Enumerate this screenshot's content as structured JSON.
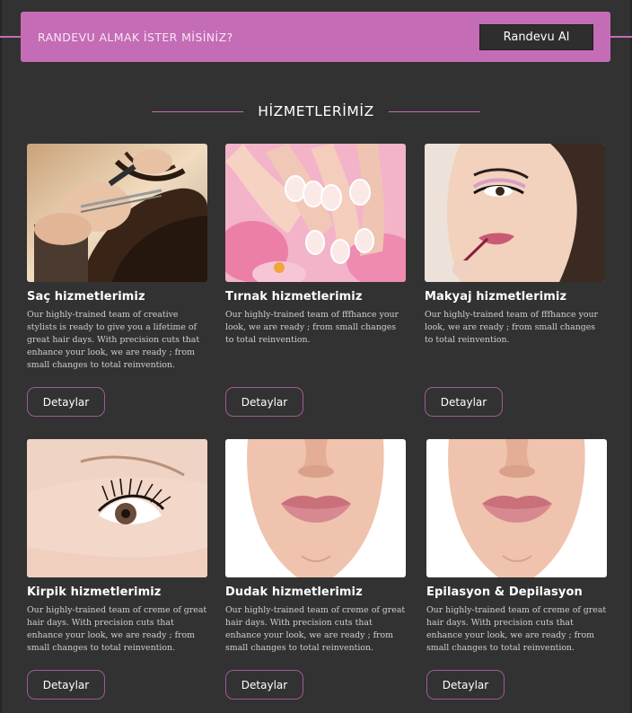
{
  "cta": {
    "text": "RANDEVU ALMAK İSTER MİSİNİZ?",
    "button_label": "Randevu Al"
  },
  "section": {
    "title": "HİZMETLERİMİZ"
  },
  "accent_color": "#c56cb6",
  "services": [
    {
      "title": "Saç hizmetlerimiz",
      "description": "Our highly-trained team of creative stylists is ready to give you a lifetime of great hair days. With precision cuts that enhance your look, we are ready ; from small changes to total reinvention.",
      "button": "Detaylar",
      "image": "hair-cutting-photo"
    },
    {
      "title": "Tırnak hizmetlerimiz",
      "description": "Our highly-trained team of fffhance your look, we are ready ; from small changes to total reinvention.",
      "button": "Detaylar",
      "image": "manicure-nails-photo"
    },
    {
      "title": "Makyaj hizmetlerimiz",
      "description": "Our highly-trained team of fffhance your look, we are ready ; from small changes to total reinvention.",
      "button": "Detaylar",
      "image": "makeup-woman-photo"
    },
    {
      "title": "Kirpik hizmetlerimiz",
      "description": "Our highly-trained team of creme of great hair days. With precision cuts that enhance your look, we are ready ; from small changes to total reinvention.",
      "button": "Detaylar",
      "image": "eyelash-closeup-photo"
    },
    {
      "title": "Dudak hizmetlerimiz",
      "description": "Our highly-trained team of creme of great hair days. With precision cuts that enhance your look, we are ready ; from small changes to total reinvention.",
      "button": "Detaylar",
      "image": "lips-face-photo"
    },
    {
      "title": "Epilasyon & Depilasyon",
      "description": "Our highly-trained team of creme of great hair days. With precision cuts that enhance your look, we are ready ; from small changes to total reinvention.",
      "button": "Detaylar",
      "image": "lips-face-photo"
    }
  ]
}
